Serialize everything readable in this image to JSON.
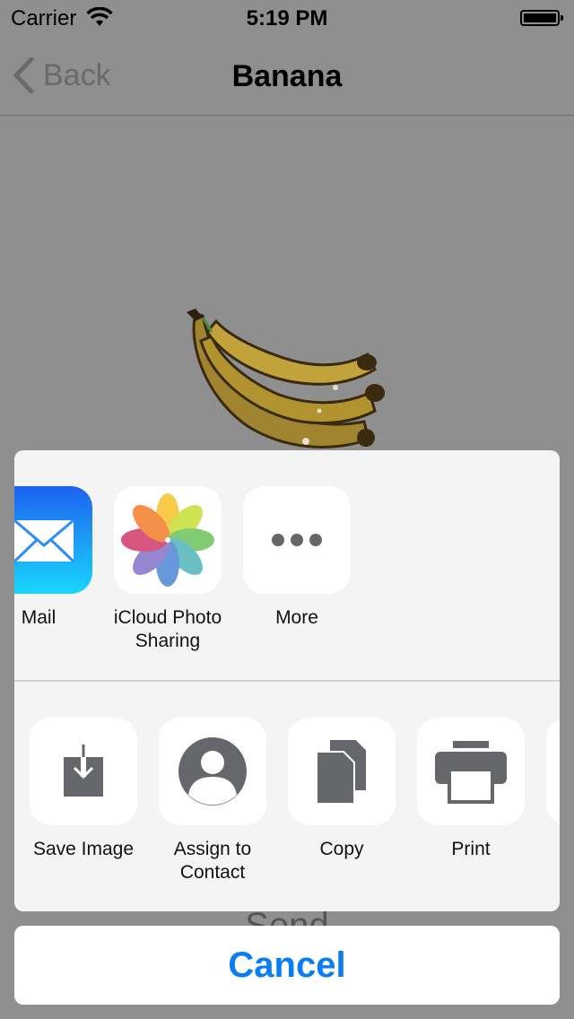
{
  "status_bar": {
    "carrier": "Carrier",
    "time": "5:19 PM"
  },
  "nav": {
    "back_label": "Back",
    "title": "Banana"
  },
  "behind": {
    "partial_text": "Send"
  },
  "share_apps": [
    {
      "label": "Mail",
      "icon": "mail-icon"
    },
    {
      "label": "iCloud Photo Sharing",
      "line1": "iCloud Photo",
      "line2": "Sharing",
      "icon": "photos-icon"
    },
    {
      "label": "More",
      "icon": "more-icon"
    }
  ],
  "share_actions": [
    {
      "label": "Save Image",
      "icon": "save-image-icon"
    },
    {
      "label": "Assign to Contact",
      "line1": "Assign to",
      "line2": "Contact",
      "icon": "contact-icon"
    },
    {
      "label": "Copy",
      "icon": "copy-icon"
    },
    {
      "label": "Print",
      "icon": "print-icon"
    }
  ],
  "cancel": {
    "label": "Cancel"
  },
  "colors": {
    "accent": "#0a7cf5",
    "icon_gray": "#66676b"
  }
}
